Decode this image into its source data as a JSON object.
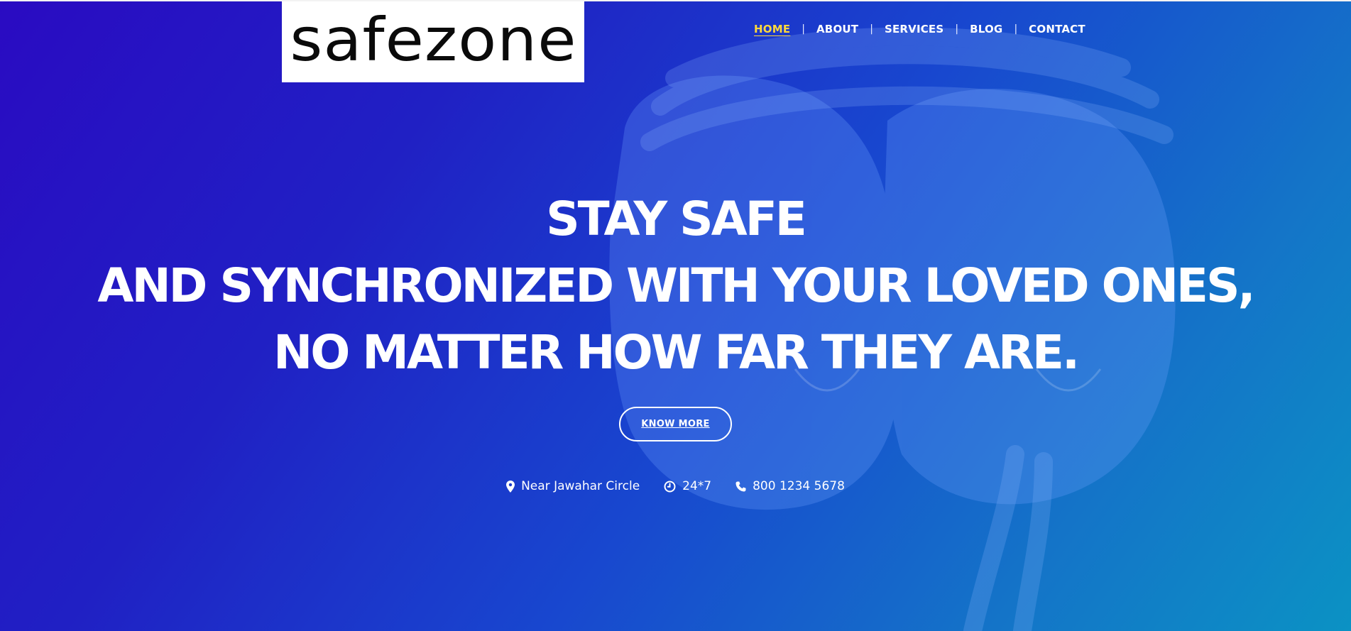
{
  "brand": {
    "logo_text": "safezone"
  },
  "nav": {
    "items": [
      {
        "label": "HOME",
        "active": true
      },
      {
        "label": "ABOUT",
        "active": false
      },
      {
        "label": "SERVICES",
        "active": false
      },
      {
        "label": "BLOG",
        "active": false
      },
      {
        "label": "CONTACT",
        "active": false
      }
    ],
    "separator": "|"
  },
  "hero": {
    "headline_lines": [
      "STAY SAFE",
      "AND SYNCHRONIZED WITH YOUR LOVED ONES,",
      "NO MATTER HOW FAR THEY ARE."
    ],
    "cta_label": "KNOW MORE"
  },
  "info": {
    "location": {
      "icon": "map-pin-icon",
      "text": "Near Jawahar Circle"
    },
    "hours": {
      "icon": "clock-icon",
      "text": "24*7"
    },
    "phone": {
      "icon": "phone-icon",
      "text": "800 1234 5678"
    }
  },
  "colors": {
    "gradient_start": "#2a0bc2",
    "gradient_end": "#0b92c4",
    "nav_active": "#ffd93b",
    "text": "#ffffff"
  }
}
